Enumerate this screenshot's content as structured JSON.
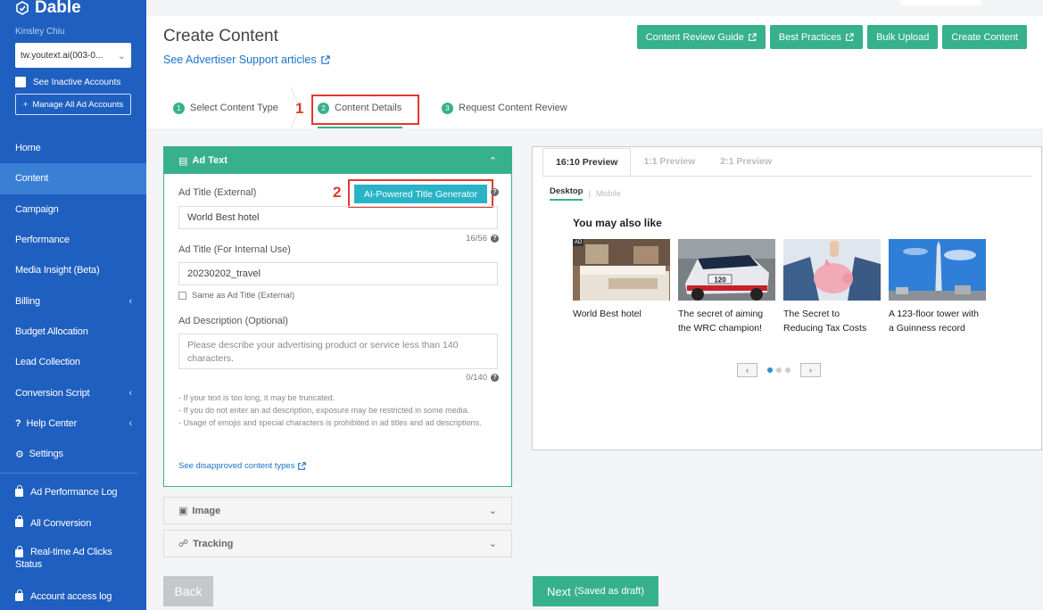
{
  "brand": {
    "name": "Dable"
  },
  "user": {
    "name": "Kinsley Chiu"
  },
  "account": {
    "selected": "tw.youtext.ai(003-0..."
  },
  "sidebar": {
    "inactive_label": "See Inactive Accounts",
    "manage_label": "Manage All Ad Accounts",
    "items": [
      {
        "label": "Home"
      },
      {
        "label": "Content"
      },
      {
        "label": "Campaign"
      },
      {
        "label": "Performance"
      },
      {
        "label": "Media Insight (Beta)"
      },
      {
        "label": "Billing"
      },
      {
        "label": "Budget Allocation"
      },
      {
        "label": "Lead Collection"
      },
      {
        "label": "Conversion Script"
      },
      {
        "label": "Help Center"
      },
      {
        "label": "Settings"
      },
      {
        "label": "Ad Performance Log"
      },
      {
        "label": "All Conversion"
      },
      {
        "label": "Real-time Ad Clicks Status"
      },
      {
        "label": "Account access log"
      }
    ]
  },
  "header": {
    "title": "Create Content",
    "support_link": "See Advertiser Support articles",
    "buttons": {
      "review_guide": "Content Review Guide",
      "best_practices": "Best Practices",
      "bulk_upload": "Bulk Upload",
      "create_content": "Create Content"
    }
  },
  "steps": [
    {
      "num": "1",
      "label": "Select Content Type"
    },
    {
      "num": "2",
      "label": "Content Details"
    },
    {
      "num": "3",
      "label": "Request Content Review"
    }
  ],
  "annotations": {
    "one": "1",
    "two": "2"
  },
  "ad_text": {
    "header": "Ad Text",
    "title_external_label": "Ad Title (External)",
    "ai_button": "AI-Powered Title Generator",
    "title_external_value": "World Best hotel",
    "title_external_count": "16/56",
    "title_internal_label": "Ad Title (For Internal Use)",
    "title_internal_value": "20230202_travel",
    "same_as_label": "Same as Ad Title (External)",
    "description_label": "Ad Description (Optional)",
    "description_placeholder": "Please describe your advertising product or service less than 140 characters.",
    "description_count": "0/140",
    "hints": [
      "- If your text is too long, it may be truncated.",
      "- If you do not enter an ad description, exposure may be restricted in some media.",
      "- Usage of emojis and special characters is prohibited in ad titles and ad descriptions."
    ],
    "disapproved_link": "See disapproved content types"
  },
  "sections": {
    "image": "Image",
    "tracking": "Tracking"
  },
  "footer": {
    "back": "Back",
    "next": "Next",
    "next_sub": "(Saved as draft)"
  },
  "preview": {
    "tabs": [
      "16:10 Preview",
      "1:1 Preview",
      "2:1 Preview"
    ],
    "device_tabs": [
      "Desktop",
      "Mobile"
    ],
    "heading": "You may also like",
    "ad_badge": "AD",
    "cards": [
      {
        "title": "World Best hotel"
      },
      {
        "title": "The secret of aiming the WRC champion!"
      },
      {
        "title": "The Secret to Reducing Tax Costs"
      },
      {
        "title": "A 123-floor tower with a Guinness record"
      }
    ],
    "car_number": "120"
  },
  "colors": {
    "sidebar": "#1f5fbf",
    "accent": "#37b18c",
    "ai_button": "#29b3c7",
    "annotation": "#e23a2c"
  }
}
